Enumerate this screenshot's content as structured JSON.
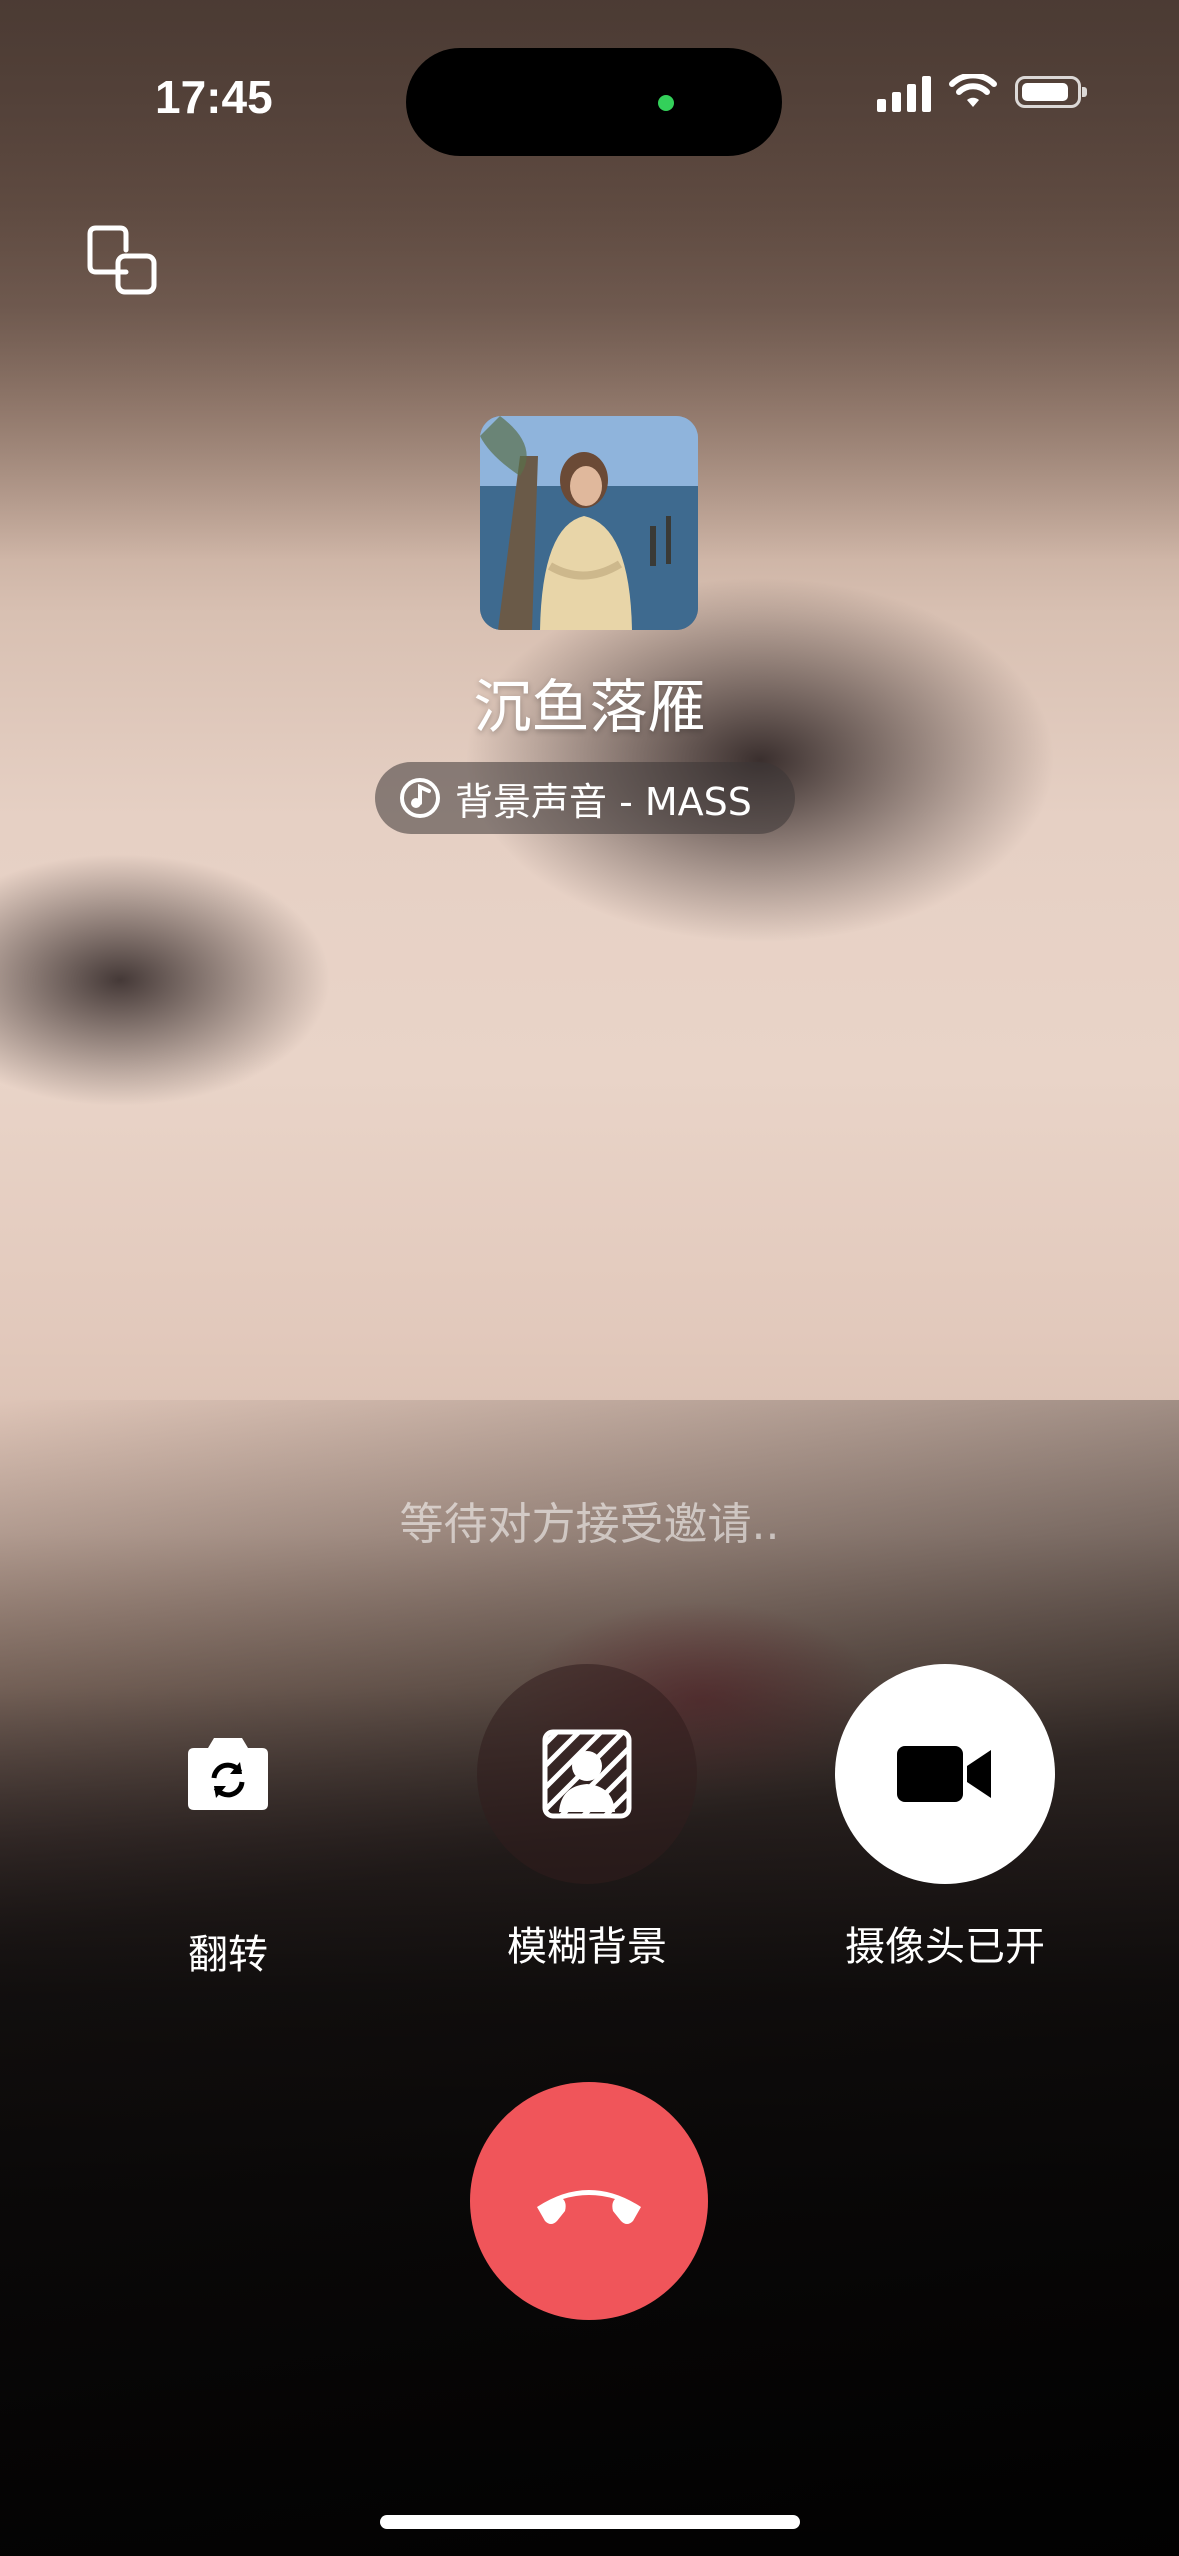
{
  "status_bar": {
    "time": "17:45",
    "battery_level": 0.85,
    "privacy_indicator_color": "#33d05a"
  },
  "call": {
    "caller_name": "沉鱼落雁",
    "background_music": "背景声音 - MASS",
    "status_text": "等待对方接受邀请.."
  },
  "controls": {
    "flip_label": "翻转",
    "blur_label": "模糊背景",
    "camera_label": "摄像头已开",
    "hangup_color": "#f0555a"
  },
  "icons": [
    "pip-switch-icon",
    "music-note-icon",
    "flip-camera-icon",
    "blur-background-icon",
    "video-camera-icon",
    "phone-hangup-icon"
  ]
}
